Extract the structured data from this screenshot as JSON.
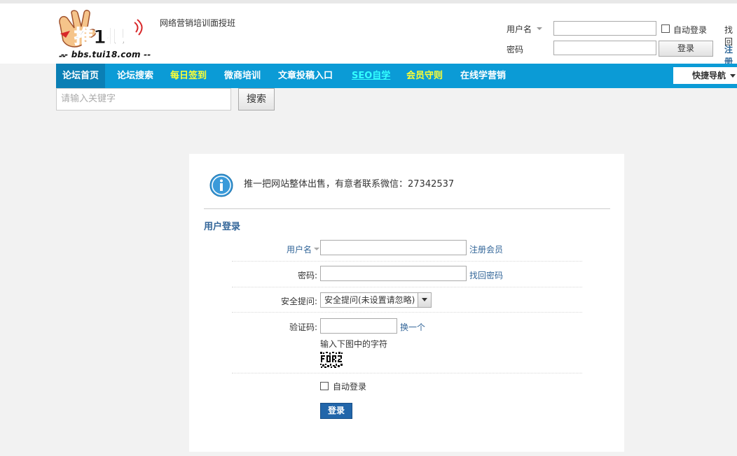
{
  "header": {
    "logo_text": "推1把",
    "logo_url_text": "bbs.tui18.com",
    "tagline": "网络营销培训面授班"
  },
  "top_login": {
    "username_label": "用户名",
    "password_label": "密码",
    "auto_login_label": "自动登录",
    "login_button": "登录",
    "forgot_link": "找回",
    "register_link": "注册"
  },
  "nav": {
    "items": [
      {
        "label": "论坛首页"
      },
      {
        "label": "论坛搜索"
      },
      {
        "label": "每日签到"
      },
      {
        "label": "微商培训"
      },
      {
        "label": "文章投稿入口"
      },
      {
        "label": "SEO自学"
      },
      {
        "label": "会员守则"
      },
      {
        "label": "在线学营销"
      }
    ],
    "quick_nav": "快捷导航"
  },
  "search": {
    "placeholder": "请输入关键字",
    "button": "搜索"
  },
  "notice": "推一把网站整体出售，有意者联系微信：27342537",
  "login_form": {
    "title": "用户登录",
    "username_label": "用户名",
    "register_link": "注册会员",
    "password_label": "密码:",
    "forgot_link": "找回密码",
    "question_label": "安全提问:",
    "question_value": "安全提问(未设置请忽略)",
    "captcha_label": "验证码:",
    "captcha_refresh": "换一个",
    "captcha_hint": "输入下图中的字符",
    "auto_login_label": "自动登录",
    "submit": "登录"
  },
  "colors": {
    "nav_bg": "#0b9bd6",
    "nav_active": "#0a7fb5",
    "link_blue": "#336699",
    "button_blue": "#2266aa"
  }
}
